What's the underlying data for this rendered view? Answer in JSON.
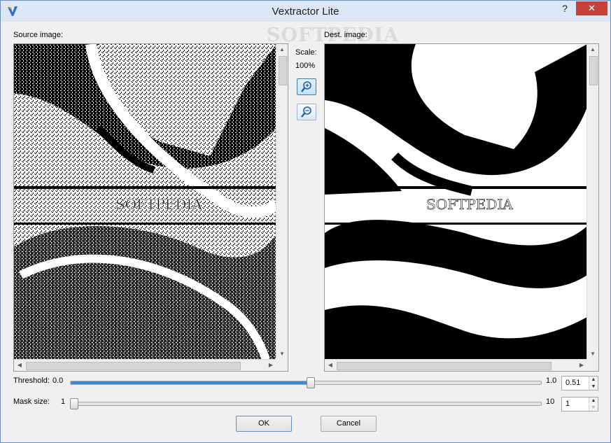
{
  "window": {
    "title": "Vextractor Lite",
    "help_label": "?",
    "close_label": "✕",
    "watermark": "SOFTPEDIA"
  },
  "source": {
    "label": "Source image:",
    "image_overlay": "SOFTPEDIA"
  },
  "dest": {
    "label": "Dest. image:",
    "image_overlay": "SOFTPEDIA"
  },
  "scale": {
    "label": "Scale:",
    "value": "100%"
  },
  "zoom": {
    "zoom_in_icon": "magnifier-plus-icon",
    "zoom_out_icon": "magnifier-minus-icon"
  },
  "threshold": {
    "label": "Threshold:",
    "min": "0.0",
    "max": "1.0",
    "value": "0.51",
    "fraction": 0.51
  },
  "mask": {
    "label": "Mask size:",
    "min": "1",
    "max": "10",
    "value": "1",
    "fraction": 0.0
  },
  "buttons": {
    "ok": "OK",
    "cancel": "Cancel"
  },
  "colors": {
    "accent": "#3d8ad0",
    "titlebar": "#dbe7f5",
    "close": "#c7413a"
  }
}
